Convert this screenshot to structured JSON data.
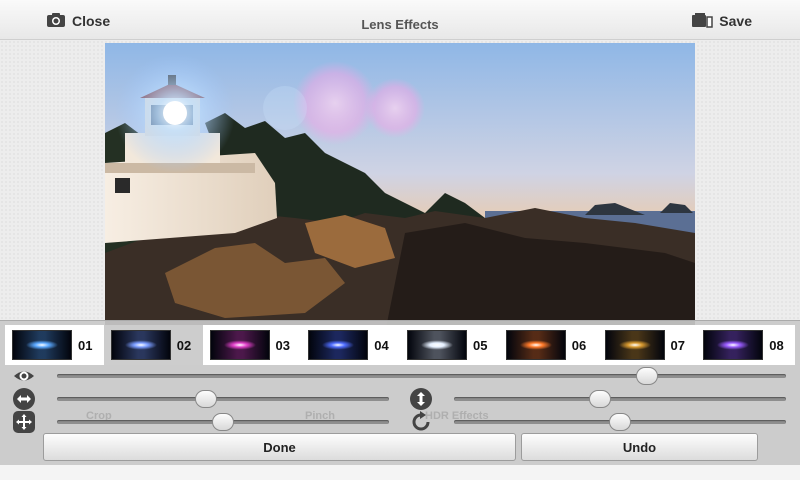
{
  "topbar": {
    "close_label": "Close",
    "title": "Lens Effects",
    "save_label": "Save",
    "close_icon": "camera-icon",
    "save_icon": "save-icon"
  },
  "effects": [
    {
      "num": "01",
      "selected": false,
      "color": "#5aa8ff"
    },
    {
      "num": "02",
      "selected": true,
      "color": "#7a9cff"
    },
    {
      "num": "03",
      "selected": false,
      "color": "#e040c8"
    },
    {
      "num": "04",
      "selected": false,
      "color": "#4f6dff"
    },
    {
      "num": "05",
      "selected": false,
      "color": "#e6f0ff"
    },
    {
      "num": "06",
      "selected": false,
      "color": "#ff7a2a"
    },
    {
      "num": "07",
      "selected": false,
      "color": "#d89a30"
    },
    {
      "num": "08",
      "selected": false,
      "color": "#9a5cff"
    }
  ],
  "sliders": {
    "opacity": {
      "icon": "eye-icon",
      "value": 0.81
    },
    "horizontal": {
      "icon": "horizontal-arrows-icon",
      "value": 0.45
    },
    "vertical": {
      "icon": "vertical-arrows-icon",
      "value": 0.44
    },
    "scale": {
      "icon": "move-icon",
      "value": 0.5
    },
    "rotate": {
      "icon": "rotate-icon",
      "value": 0.5
    }
  },
  "ghost_text": {
    "left": "Crop",
    "mid": "Pinch",
    "right": "HDR Effects"
  },
  "buttons": {
    "done_label": "Done",
    "undo_label": "Undo"
  }
}
